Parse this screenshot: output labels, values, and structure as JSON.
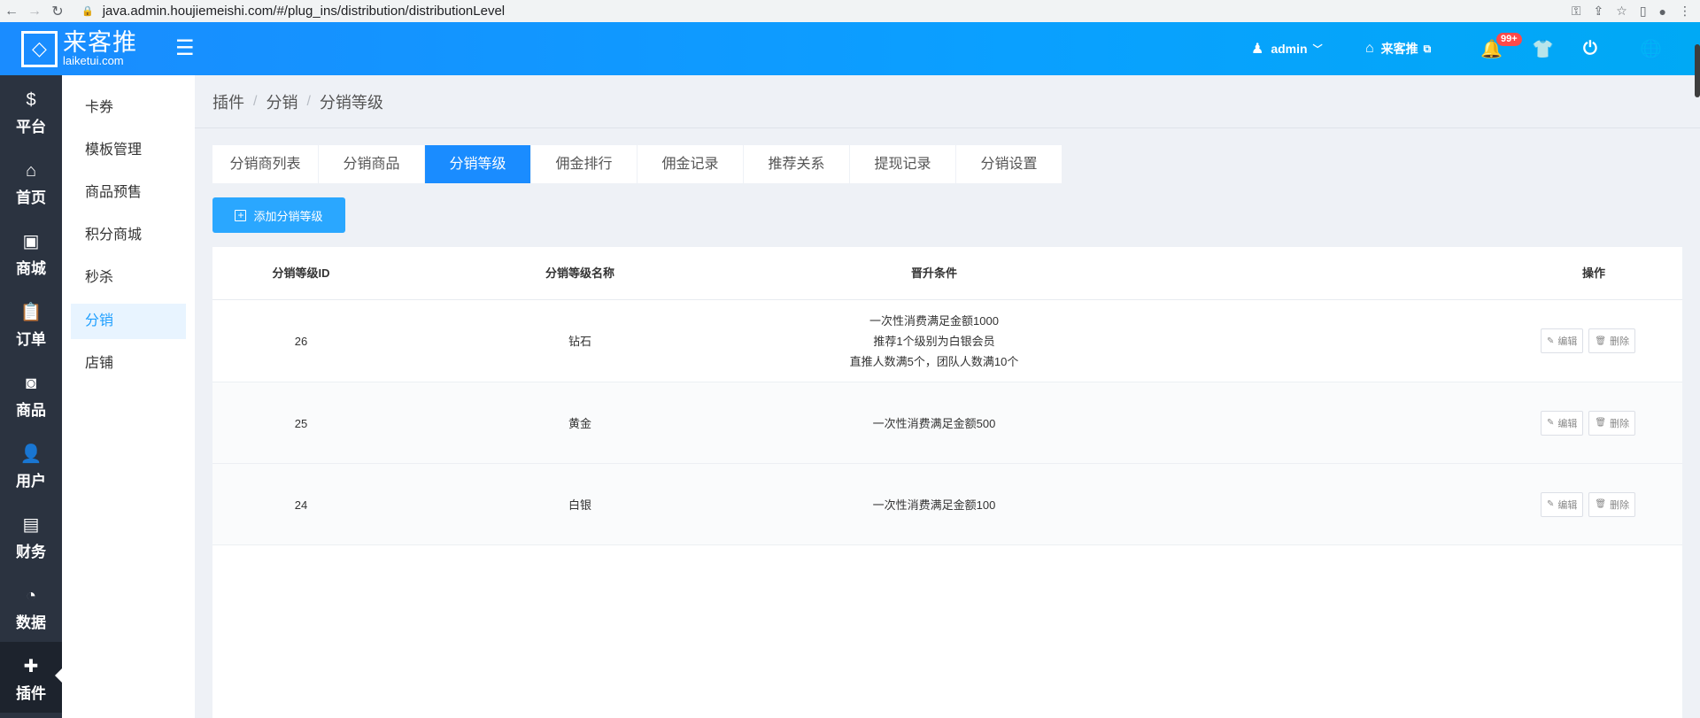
{
  "browser": {
    "url": "java.admin.houjiemeishi.com/#/plug_ins/distribution/distributionLevel"
  },
  "header": {
    "logo_cn": "来客推",
    "logo_en": "laiketui.com",
    "user": "admin",
    "store_label": "来客推",
    "notif_badge": "99+"
  },
  "leftnav": [
    {
      "label": "平台",
      "icon": "dollar-icon"
    },
    {
      "label": "首页",
      "icon": "home-icon"
    },
    {
      "label": "商城",
      "icon": "store-icon"
    },
    {
      "label": "订单",
      "icon": "clipboard-icon"
    },
    {
      "label": "商品",
      "icon": "bag-icon"
    },
    {
      "label": "用户",
      "icon": "user-icon"
    },
    {
      "label": "财务",
      "icon": "wallet-icon"
    },
    {
      "label": "数据",
      "icon": "pie-chart-icon"
    },
    {
      "label": "插件",
      "icon": "puzzle-icon"
    }
  ],
  "subnav": [
    "卡券",
    "模板管理",
    "商品预售",
    "积分商城",
    "秒杀",
    "分销",
    "店铺"
  ],
  "breadcrumb": [
    "插件",
    "分销",
    "分销等级"
  ],
  "tabs": [
    "分销商列表",
    "分销商品",
    "分销等级",
    "佣金排行",
    "佣金记录",
    "推荐关系",
    "提现记录",
    "分销设置"
  ],
  "add_button": "添加分销等级",
  "table": {
    "headers": [
      "分销等级ID",
      "分销等级名称",
      "晋升条件",
      "操作"
    ],
    "rows": [
      {
        "id": "26",
        "name": "钻石",
        "conditions": [
          "一次性消费满足金额1000",
          "推荐1个级别为白银会员",
          "直推人数满5个，团队人数满10个"
        ]
      },
      {
        "id": "25",
        "name": "黄金",
        "conditions": [
          "一次性消费满足金额500"
        ]
      },
      {
        "id": "24",
        "name": "白银",
        "conditions": [
          "一次性消费满足金额100"
        ]
      }
    ],
    "edit_label": "编辑",
    "delete_label": "删除"
  }
}
